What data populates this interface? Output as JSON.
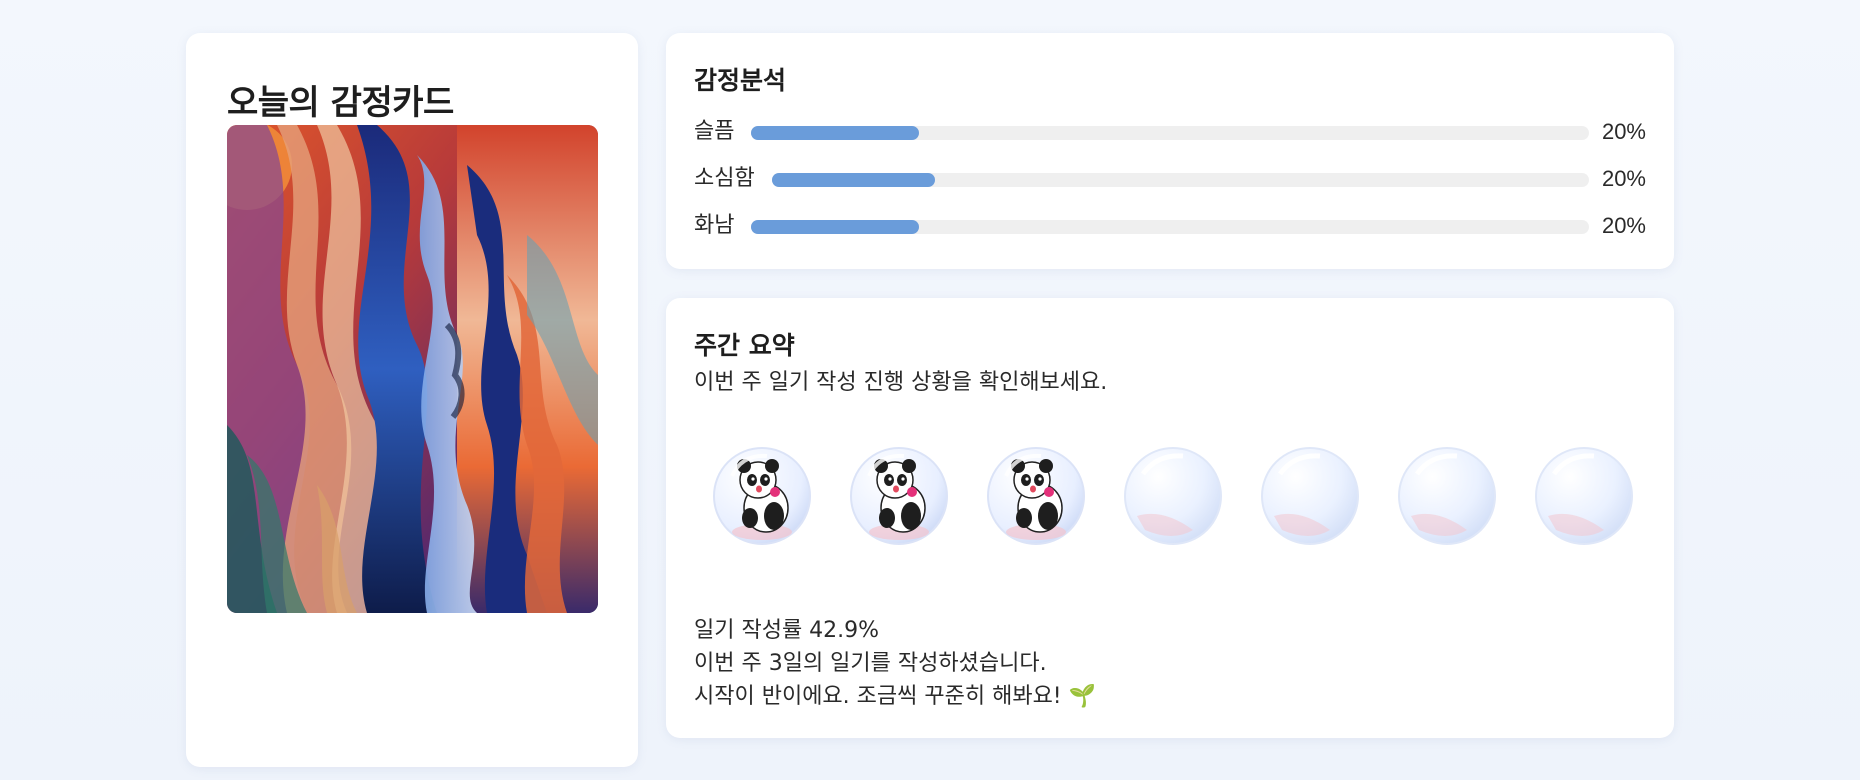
{
  "emotion_card": {
    "title": "오늘의 감정카드",
    "image_alt": "abstract-face-painting"
  },
  "analysis": {
    "title": "감정분석",
    "items": [
      {
        "label": "슬픔",
        "percent": 20,
        "percent_text": "20%"
      },
      {
        "label": "소심함",
        "percent": 20,
        "percent_text": "20%"
      },
      {
        "label": "화남",
        "percent": 20,
        "percent_text": "20%"
      }
    ],
    "bar_color": "#6a9cda"
  },
  "weekly": {
    "title": "주간 요약",
    "subtitle": "이번 주 일기 작성 진행 상황을 확인해보세요.",
    "days": [
      {
        "written": true,
        "icon": "panda-bubble-icon"
      },
      {
        "written": true,
        "icon": "panda-bubble-icon"
      },
      {
        "written": true,
        "icon": "panda-bubble-icon"
      },
      {
        "written": false,
        "icon": "empty-bubble-icon"
      },
      {
        "written": false,
        "icon": "empty-bubble-icon"
      },
      {
        "written": false,
        "icon": "empty-bubble-icon"
      },
      {
        "written": false,
        "icon": "empty-bubble-icon"
      }
    ],
    "rate_text": "일기 작성률 42.9%",
    "count_text": "이번 주 3일의 일기를 작성하셨습니다.",
    "encourage_text": "시작이 반이에요. 조금씩 꾸준히 해봐요! 🌱"
  }
}
